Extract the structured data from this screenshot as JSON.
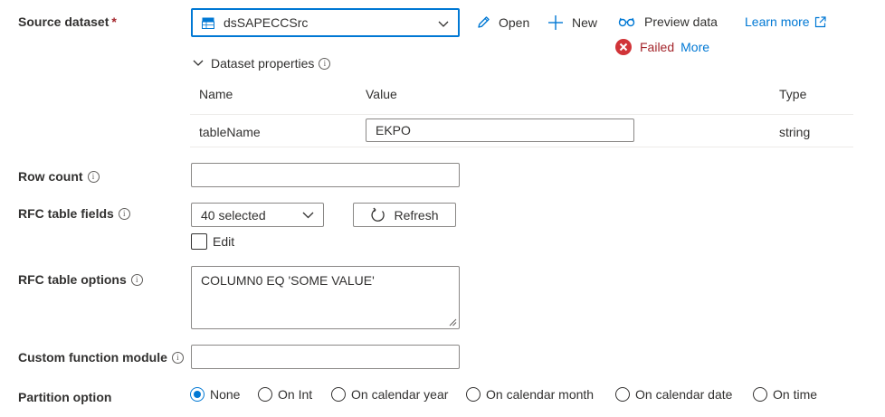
{
  "source_dataset": {
    "label": "Source dataset",
    "required_mark": "*",
    "selected_value": "dsSAPECCSrc",
    "open_label": "Open",
    "new_label": "New",
    "preview_label": "Preview data",
    "learn_more_label": "Learn more",
    "failed_label": "Failed",
    "more_label": "More"
  },
  "dataset_properties": {
    "title": "Dataset properties",
    "columns": [
      "Name",
      "Value",
      "Type"
    ],
    "rows": [
      {
        "name": "tableName",
        "value": "EKPO",
        "type": "string"
      }
    ]
  },
  "row_count": {
    "label": "Row count",
    "value": ""
  },
  "rfc_table_fields": {
    "label": "RFC table fields",
    "selected": "40 selected",
    "refresh_label": "Refresh",
    "edit_label": "Edit"
  },
  "rfc_table_options": {
    "label": "RFC table options",
    "value": "COLUMN0 EQ 'SOME VALUE'"
  },
  "custom_function_module": {
    "label": "Custom function module",
    "value": ""
  },
  "partition_option": {
    "label": "Partition option",
    "options": [
      "None",
      "On Int",
      "On calendar year",
      "On calendar month",
      "On calendar date",
      "On time"
    ],
    "selected": "None"
  },
  "colors": {
    "accent": "#0078d4",
    "error": "#d13438",
    "required": "#a4262c"
  }
}
